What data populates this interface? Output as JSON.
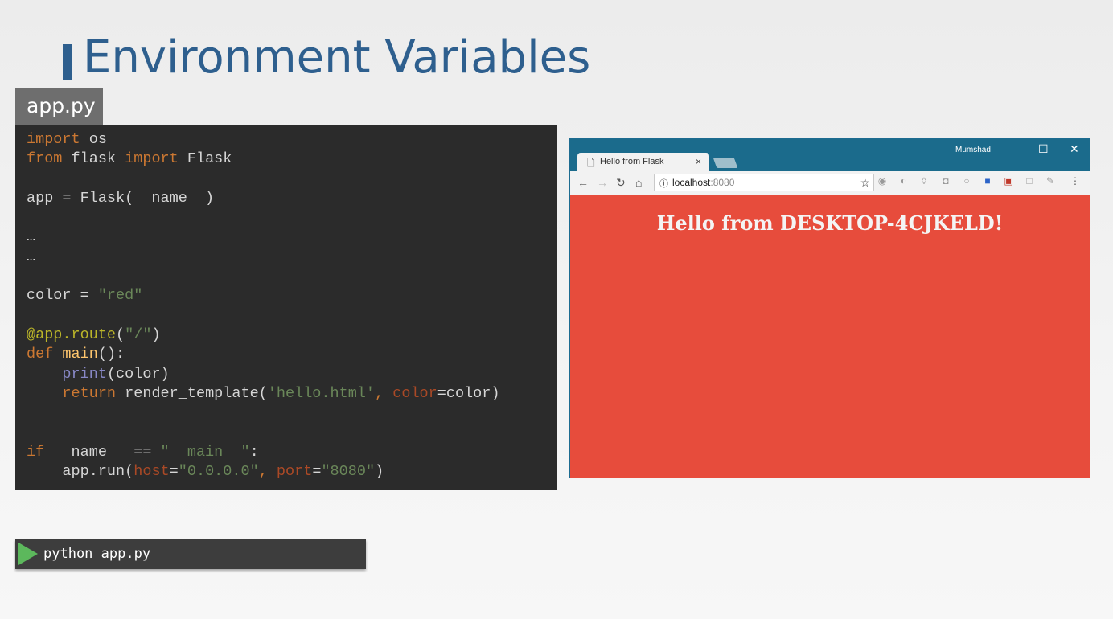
{
  "slide": {
    "title": "Environment Variables"
  },
  "file_tab": {
    "label": "app.py"
  },
  "code": {
    "l1": {
      "t1": "import",
      "t2": " os"
    },
    "l2": {
      "t1": "from",
      "t2": " flask ",
      "t3": "import",
      "t4": " Flask"
    },
    "l4": {
      "t1": "app = Flask(__name__)"
    },
    "l6": {
      "t1": "…"
    },
    "l7": {
      "t1": "…"
    },
    "l9": {
      "t1": "color = ",
      "t2": "\"red\""
    },
    "l11": {
      "t1": "@app.route",
      "t2": "(",
      "t3": "\"/\"",
      "t4": ")"
    },
    "l12": {
      "t1": "def",
      "t2": " ",
      "t3": "main",
      "t4": "():"
    },
    "l13": {
      "t1": "    ",
      "t2": "print",
      "t3": "(color)"
    },
    "l14": {
      "t1": "    ",
      "t2": "return",
      "t3": " render_template(",
      "t4": "'hello.html'",
      "t5": ", ",
      "t6": "color",
      "t7": "=color)"
    },
    "l17": {
      "t1": "if",
      "t2": " __name__ == ",
      "t3": "\"__main__\"",
      "t4": ":"
    },
    "l18": {
      "t1": "    app.run(",
      "t2": "host",
      "t3": "=",
      "t4": "\"0.0.0.0\"",
      "t5": ", ",
      "t6": "port",
      "t7": "=",
      "t8": "\"8080\"",
      "t9": ")"
    }
  },
  "browser": {
    "tab_title": "Hello from Flask",
    "tab_close": "×",
    "user_name": "Mumshad",
    "window_controls": {
      "minimize": "—",
      "maximize": "☐",
      "close": "✕"
    },
    "url_host": "localhost",
    "url_port": ":8080",
    "page_heading": "Hello from DESKTOP-4CJKELD!",
    "page_background": "#e74c3c"
  },
  "terminal": {
    "command": "python app.py"
  }
}
